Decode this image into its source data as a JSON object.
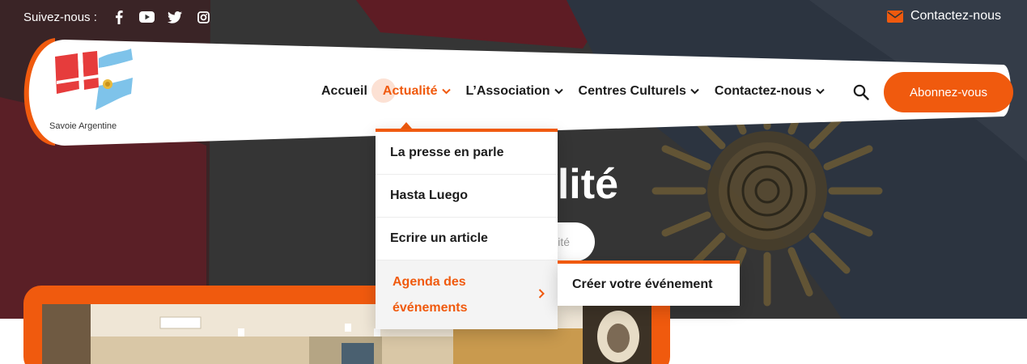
{
  "topbar": {
    "follow_label": "Suivez-nous :",
    "social_icons": [
      "facebook-icon",
      "youtube-icon",
      "twitter-icon",
      "instagram-icon"
    ],
    "contact_label": "Contactez-nous"
  },
  "brand": {
    "name": "Savoie Argentine"
  },
  "nav": {
    "items": [
      {
        "label": "Accueil",
        "has_dropdown": false,
        "active": false
      },
      {
        "label": "Actualité",
        "has_dropdown": true,
        "active": true
      },
      {
        "label": "L’Association",
        "has_dropdown": true,
        "active": false
      },
      {
        "label": "Centres Culturels",
        "has_dropdown": true,
        "active": false
      },
      {
        "label": "Contactez-nous",
        "has_dropdown": true,
        "active": false
      }
    ],
    "subscribe_label": "Abonnez-vous"
  },
  "dropdown": {
    "items": [
      {
        "label": "La presse en parle"
      },
      {
        "label": "Hasta Luego"
      },
      {
        "label": "Ecrire un article"
      },
      {
        "label": "Agenda des événements",
        "has_submenu": true
      }
    ],
    "submenu": {
      "items": [
        {
          "label": "Créer votre événement"
        }
      ]
    }
  },
  "page": {
    "title_fragment": "lité",
    "breadcrumb_fragment": "ité"
  },
  "colors": {
    "accent": "#f05a0e",
    "dark": "#333333",
    "text": "#1c1c1c"
  }
}
